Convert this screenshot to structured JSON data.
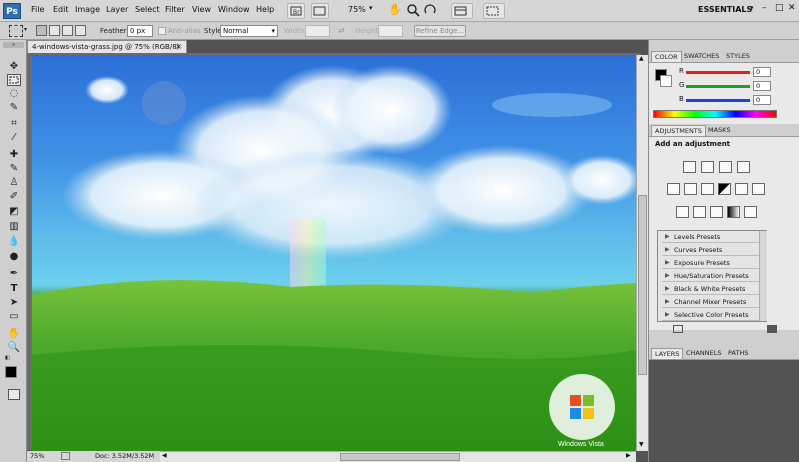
{
  "app": {
    "logo": "Ps"
  },
  "menu": [
    "File",
    "Edit",
    "Image",
    "Layer",
    "Select",
    "Filter",
    "View",
    "Window",
    "Help"
  ],
  "toolbar_top": {
    "zoom": "75%",
    "workspace": "ESSENTIALS"
  },
  "window_controls": [
    "–",
    "□",
    "✕"
  ],
  "options_bar": {
    "feather_label": "Feather:",
    "feather_value": "0 px",
    "antialias_label": "Anti-alias",
    "style_label": "Style:",
    "style_value": "Normal",
    "width_label": "Width:",
    "height_label": "Height:",
    "refine_label": "Refine Edge..."
  },
  "document": {
    "tab_title": "4-windows-vista-grass.jpg @ 75% (RGB/8)",
    "close": "×",
    "watermark": "Windows Vista"
  },
  "status": {
    "zoom": "75%",
    "doc_size": "Doc: 3.52M/3.52M"
  },
  "color_panel": {
    "tabs": [
      "COLOR",
      "SWATCHES",
      "STYLES"
    ],
    "channels": [
      {
        "label": "R",
        "value": "0",
        "color": "#e02020"
      },
      {
        "label": "G",
        "value": "0",
        "color": "#20a020"
      },
      {
        "label": "B",
        "value": "0",
        "color": "#2040e0"
      }
    ]
  },
  "adjustments_panel": {
    "tabs": [
      "ADJUSTMENTS",
      "MASKS"
    ],
    "heading": "Add an adjustment",
    "presets": [
      "Levels Presets",
      "Curves Presets",
      "Exposure Presets",
      "Hue/Saturation Presets",
      "Black & White Presets",
      "Channel Mixer Presets",
      "Selective Color Presets"
    ]
  },
  "layers_panel": {
    "tabs": [
      "LAYERS",
      "CHANNELS",
      "PATHS"
    ]
  }
}
